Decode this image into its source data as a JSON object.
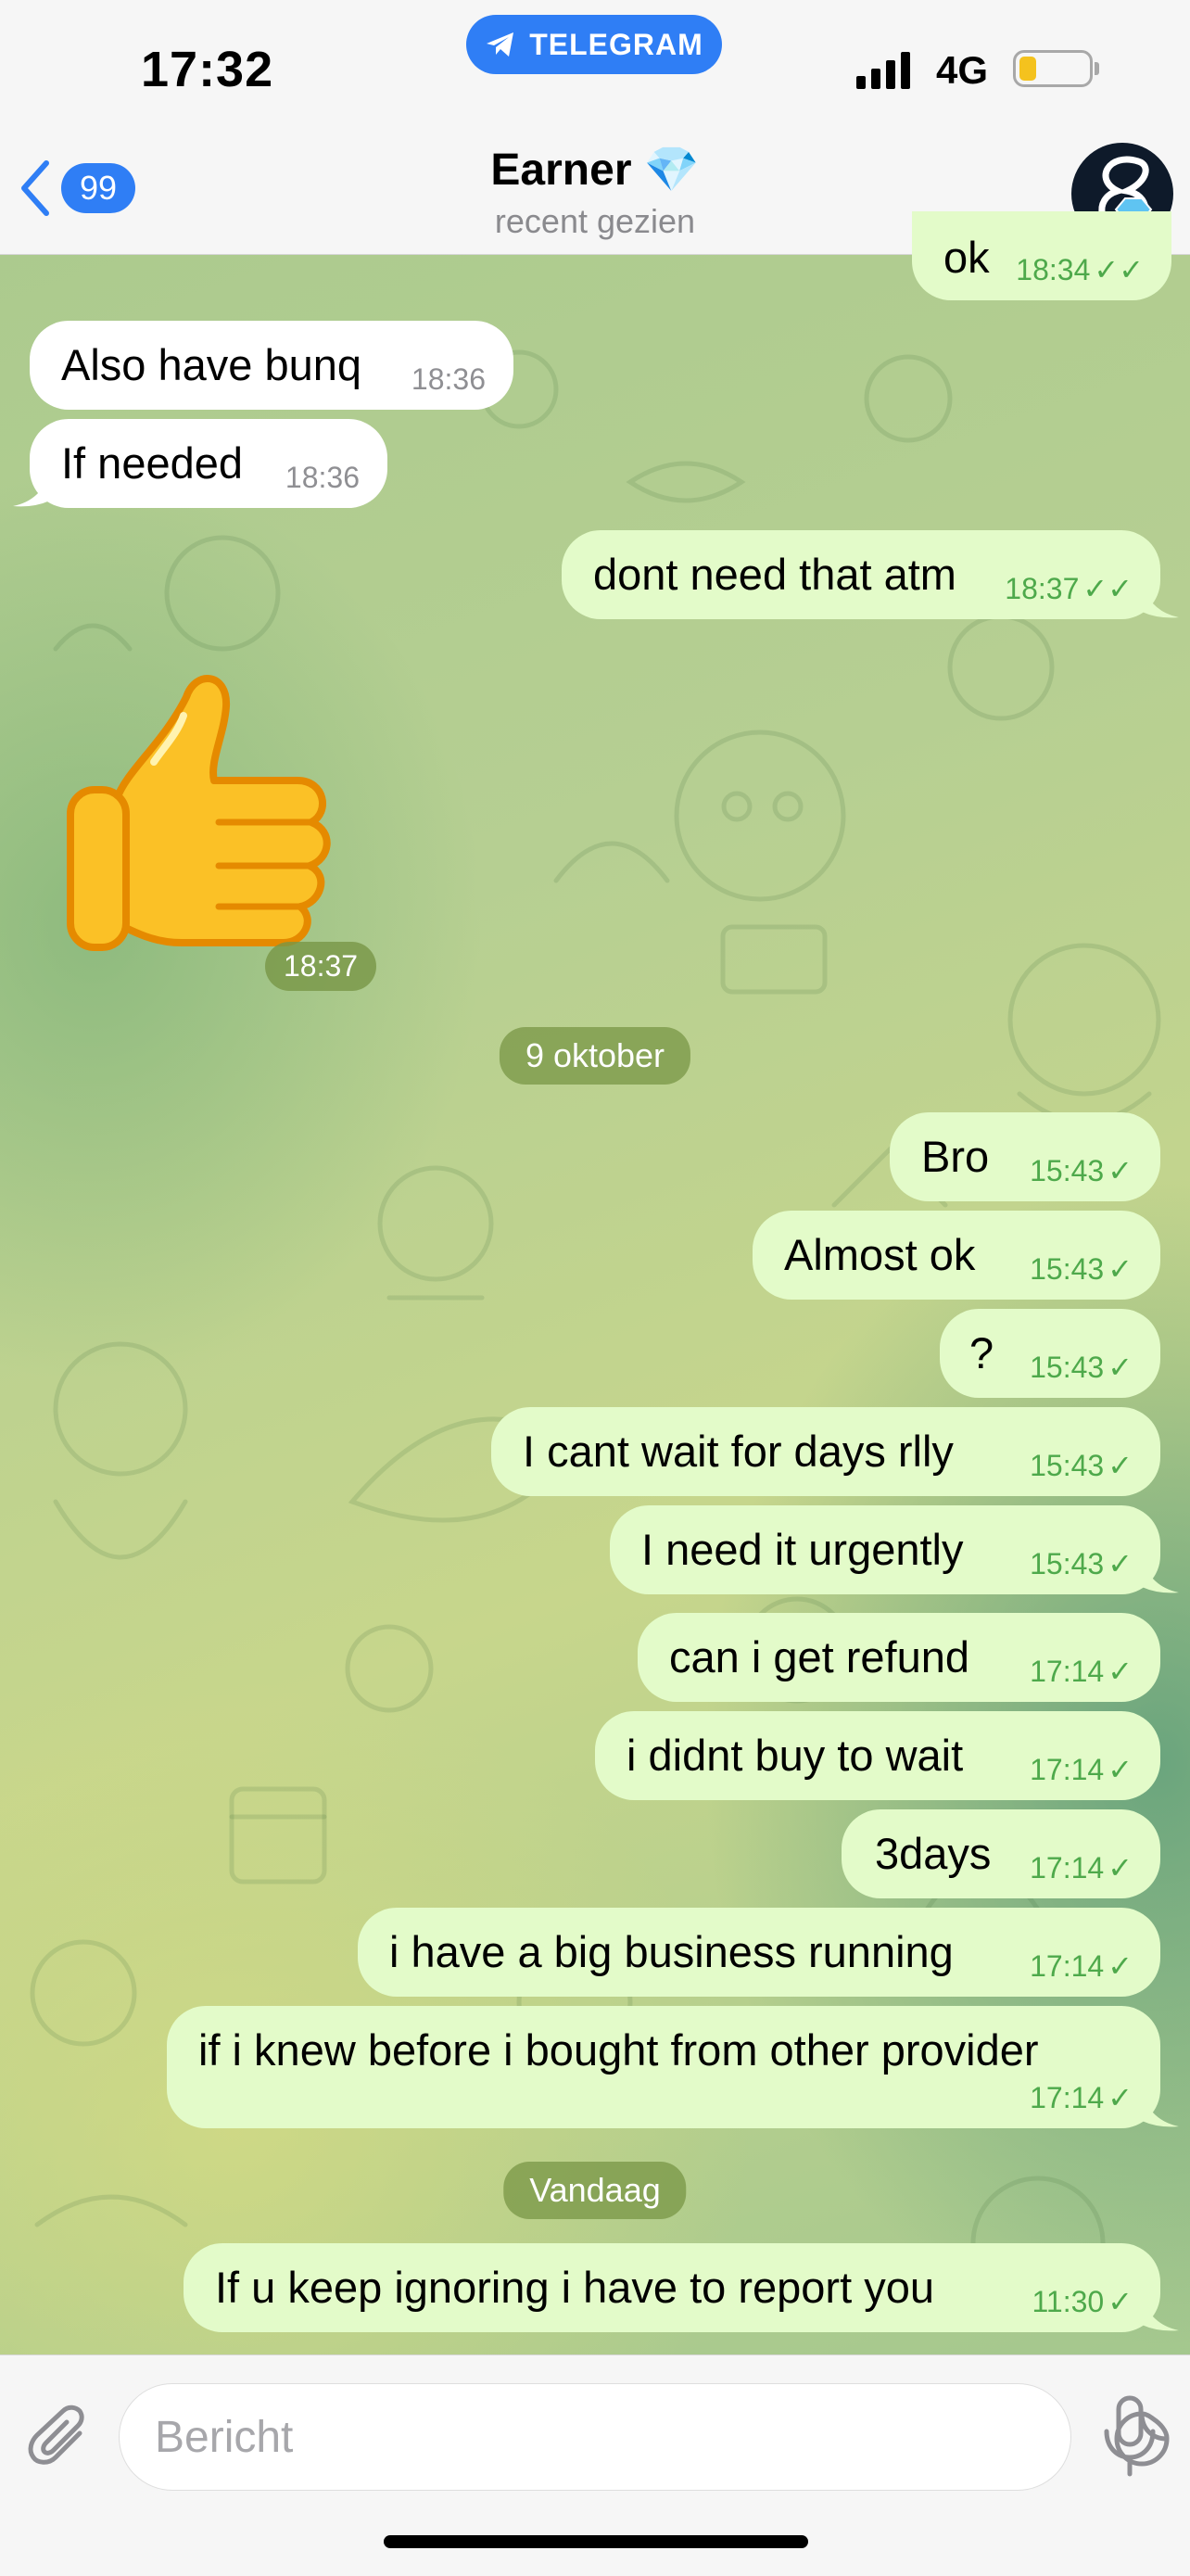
{
  "status": {
    "time": "17:32",
    "app_pill": "TELEGRAM",
    "network": "4G"
  },
  "header": {
    "back_count": "99",
    "title": "Earner 💎",
    "subtitle": "recent gezien"
  },
  "messages": [
    {
      "text": "ok",
      "time": "18:34",
      "direction": "out",
      "read": true
    },
    {
      "text": "Also have bunq",
      "time": "18:36",
      "direction": "in"
    },
    {
      "text": "If needed",
      "time": "18:36",
      "direction": "in"
    },
    {
      "text": "dont need that atm",
      "time": "18:37",
      "direction": "out",
      "read": true
    },
    {
      "sticker": "thumbs-up",
      "time": "18:37",
      "direction": "in"
    },
    {
      "date": "9 oktober"
    },
    {
      "text": "Bro",
      "time": "15:43",
      "direction": "out"
    },
    {
      "text": "Almost ok",
      "time": "15:43",
      "direction": "out"
    },
    {
      "text": "?",
      "time": "15:43",
      "direction": "out"
    },
    {
      "text": "I cant wait for days rlly",
      "time": "15:43",
      "direction": "out"
    },
    {
      "text": "I need it urgently",
      "time": "15:43",
      "direction": "out"
    },
    {
      "text": "can i get refund",
      "time": "17:14",
      "direction": "out"
    },
    {
      "text": "i didnt buy to wait",
      "time": "17:14",
      "direction": "out"
    },
    {
      "text": "3days",
      "time": "17:14",
      "direction": "out"
    },
    {
      "text": "i have a big business running",
      "time": "17:14",
      "direction": "out"
    },
    {
      "text": "if i knew before i bought from other provider",
      "time": "17:14",
      "direction": "out"
    },
    {
      "date": "Vandaag"
    },
    {
      "text": "If u keep ignoring i have to report you",
      "time": "11:30",
      "direction": "out"
    }
  ],
  "composer": {
    "placeholder": "Bericht"
  },
  "colors": {
    "accent": "#2f7ef5",
    "outgoing_bubble": "#e3fbc9",
    "incoming_bubble": "#ffffff",
    "check_green": "#4ea94b"
  }
}
